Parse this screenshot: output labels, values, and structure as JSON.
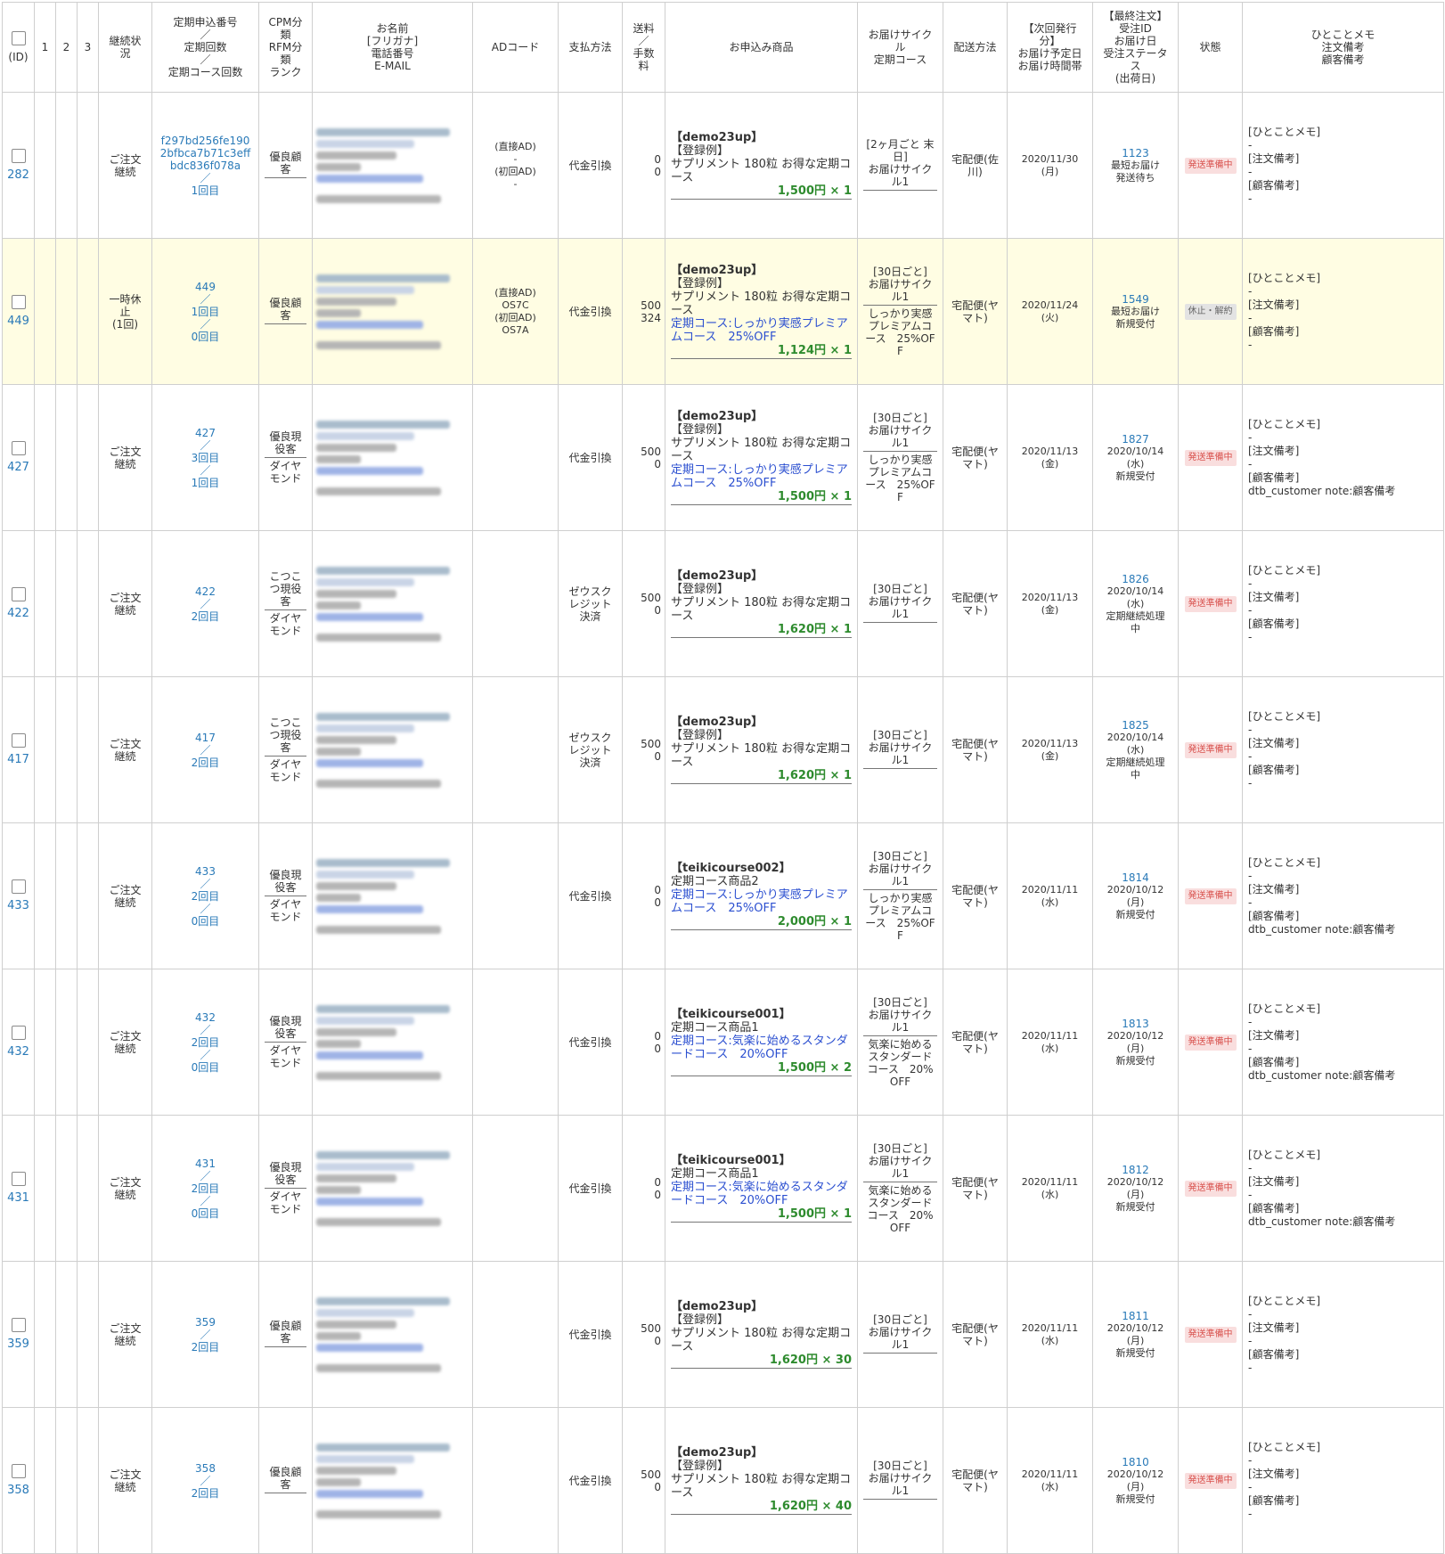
{
  "headers": {
    "id": "(ID)",
    "c1": "1",
    "c2": "2",
    "c3": "3",
    "status": "継続状\n況",
    "regular_no": "定期申込番号\n／\n定期回数\n／\n定期コース回数",
    "cpm": "CPM分\n類\nRFM分\n類\nランク",
    "name": "お名前\n[フリガナ]\n電話番号\nE-MAIL",
    "ad": "ADコード",
    "payment": "支払方法",
    "fee": "送料\n／\n手数\n料",
    "product": "お申込み商品",
    "cycle": "お届けサイク\nル\n定期コース",
    "delivery": "配送方法",
    "next": "【次回発行\n分】\nお届け予定日\nお届け時間帯",
    "last": "【最終注文】\n受注ID\nお届け日\n受注ステータ\nス\n(出荷日)",
    "state": "状態",
    "memo": "ひとことメモ\n注文備考\n顧客備考"
  },
  "memo_labels": {
    "a": "[ひとことメモ]",
    "b": "[注文備考]",
    "c": "[顧客備考]",
    "dash": "-"
  },
  "rows": [
    {
      "id": "282",
      "status": "ご注文\n継続",
      "regular": "f297bd256fe190\n2bfbca7b71c3eff\nbdc836f078a\n／\n1回目",
      "cpm1": "優良顧\n客",
      "cpm2": "",
      "ad": "(直接AD)\n-\n(初回AD)\n-",
      "payment": "代金引換",
      "fee": "0\n0",
      "code": "【demo23up】",
      "pname": "【登録例】\nサプリメント 180粒 お得な定期コ\nース",
      "course": "",
      "price": "1,500円 × 1",
      "cycle1": "[2ヶ月ごと 末\n日]\nお届けサイク\nル1",
      "cycle2": "",
      "delivery": "宅配便(佐\n川)",
      "next": "2020/11/30\n(月)",
      "order_id": "1123",
      "order_info": "最短お届け\n発送待ち",
      "badge": "発送準備中",
      "badge_type": "ship",
      "note": "-"
    },
    {
      "id": "449",
      "status": "一時休\n止\n(1回)",
      "regular": "449\n／\n1回目\n／\n0回目",
      "cpm1": "優良顧\n客",
      "cpm2": "",
      "ad": "(直接AD)\nOS7C\n(初回AD)\nOS7A",
      "payment": "代金引換",
      "fee": "500\n324",
      "code": "【demo23up】",
      "pname": "【登録例】\nサプリメント 180粒 お得な定期コ\nース",
      "course": "定期コース:しっかり実感プレミア\nムコース　25%OFF",
      "price": "1,124円 × 1",
      "cycle1": "[30日ごと]\nお届けサイク\nル1",
      "cycle2": "しっかり実感\nプレミアムコ\nース　25%OF\nF",
      "delivery": "宅配便(ヤ\nマト)",
      "next": "2020/11/24\n(火)",
      "order_id": "1549",
      "order_info": "最短お届け\n新規受付",
      "badge": "休止・解約",
      "badge_type": "stop",
      "note": "-",
      "highlight": true
    },
    {
      "id": "427",
      "status": "ご注文\n継続",
      "regular": "427\n／\n3回目\n／\n1回目",
      "cpm1": "優良現\n役客",
      "cpm2": "ダイヤ\nモンド",
      "ad": "",
      "payment": "代金引換",
      "fee": "500\n0",
      "code": "【demo23up】",
      "pname": "【登録例】\nサプリメント 180粒 お得な定期コ\nース",
      "course": "定期コース:しっかり実感プレミア\nムコース　25%OFF",
      "price": "1,500円 × 1",
      "cycle1": "[30日ごと]\nお届けサイク\nル1",
      "cycle2": "しっかり実感\nプレミアムコ\nース　25%OF\nF",
      "delivery": "宅配便(ヤ\nマト)",
      "next": "2020/11/13\n(金)",
      "order_id": "1827",
      "order_info": "2020/10/14\n(水)\n新規受付",
      "badge": "発送準備中",
      "badge_type": "ship",
      "note": "dtb_customer note:顧客備考"
    },
    {
      "id": "422",
      "status": "ご注文\n継続",
      "regular": "422\n／\n2回目",
      "cpm1": "こつこ\nつ現役\n客",
      "cpm2": "ダイヤ\nモンド",
      "ad": "",
      "payment": "ゼウスク\nレジット\n決済",
      "fee": "500\n0",
      "code": "【demo23up】",
      "pname": "【登録例】\nサプリメント 180粒 お得な定期コ\nース",
      "course": "",
      "price": "1,620円 × 1",
      "cycle1": "[30日ごと]\nお届けサイク\nル1",
      "cycle2": "",
      "delivery": "宅配便(ヤ\nマト)",
      "next": "2020/11/13\n(金)",
      "order_id": "1826",
      "order_info": "2020/10/14\n(水)\n定期継続処理\n中",
      "badge": "発送準備中",
      "badge_type": "ship",
      "note": "-"
    },
    {
      "id": "417",
      "status": "ご注文\n継続",
      "regular": "417\n／\n2回目",
      "cpm1": "こつこ\nつ現役\n客",
      "cpm2": "ダイヤ\nモンド",
      "ad": "",
      "payment": "ゼウスク\nレジット\n決済",
      "fee": "500\n0",
      "code": "【demo23up】",
      "pname": "【登録例】\nサプリメント 180粒 お得な定期コ\nース",
      "course": "",
      "price": "1,620円 × 1",
      "cycle1": "[30日ごと]\nお届けサイク\nル1",
      "cycle2": "",
      "delivery": "宅配便(ヤ\nマト)",
      "next": "2020/11/13\n(金)",
      "order_id": "1825",
      "order_info": "2020/10/14\n(水)\n定期継続処理\n中",
      "badge": "発送準備中",
      "badge_type": "ship",
      "note": "-"
    },
    {
      "id": "433",
      "status": "ご注文\n継続",
      "regular": "433\n／\n2回目\n／\n0回目",
      "cpm1": "優良現\n役客",
      "cpm2": "ダイヤ\nモンド",
      "ad": "",
      "payment": "代金引換",
      "fee": "0\n0",
      "code": "【teikicourse002】",
      "pname": "定期コース商品2",
      "course": "定期コース:しっかり実感プレミア\nムコース　25%OFF",
      "price": "2,000円 × 1",
      "cycle1": "[30日ごと]\nお届けサイク\nル1",
      "cycle2": "しっかり実感\nプレミアムコ\nース　25%OF\nF",
      "delivery": "宅配便(ヤ\nマト)",
      "next": "2020/11/11\n(水)",
      "order_id": "1814",
      "order_info": "2020/10/12\n(月)\n新規受付",
      "badge": "発送準備中",
      "badge_type": "ship",
      "note": "dtb_customer note:顧客備考"
    },
    {
      "id": "432",
      "status": "ご注文\n継続",
      "regular": "432\n／\n2回目\n／\n0回目",
      "cpm1": "優良現\n役客",
      "cpm2": "ダイヤ\nモンド",
      "ad": "",
      "payment": "代金引換",
      "fee": "0\n0",
      "code": "【teikicourse001】",
      "pname": "定期コース商品1",
      "course": "定期コース:気楽に始めるスタンダ\nードコース　20%OFF",
      "price": "1,500円 × 2",
      "cycle1": "[30日ごと]\nお届けサイク\nル1",
      "cycle2": "気楽に始める\nスタンダード\nコース　20%\nOFF",
      "delivery": "宅配便(ヤ\nマト)",
      "next": "2020/11/11\n(水)",
      "order_id": "1813",
      "order_info": "2020/10/12\n(月)\n新規受付",
      "badge": "発送準備中",
      "badge_type": "ship",
      "note": "dtb_customer note:顧客備考"
    },
    {
      "id": "431",
      "status": "ご注文\n継続",
      "regular": "431\n／\n2回目\n／\n0回目",
      "cpm1": "優良現\n役客",
      "cpm2": "ダイヤ\nモンド",
      "ad": "",
      "payment": "代金引換",
      "fee": "0\n0",
      "code": "【teikicourse001】",
      "pname": "定期コース商品1",
      "course": "定期コース:気楽に始めるスタンダ\nードコース　20%OFF",
      "price": "1,500円 × 1",
      "cycle1": "[30日ごと]\nお届けサイク\nル1",
      "cycle2": "気楽に始める\nスタンダード\nコース　20%\nOFF",
      "delivery": "宅配便(ヤ\nマト)",
      "next": "2020/11/11\n(水)",
      "order_id": "1812",
      "order_info": "2020/10/12\n(月)\n新規受付",
      "badge": "発送準備中",
      "badge_type": "ship",
      "note": "dtb_customer note:顧客備考"
    },
    {
      "id": "359",
      "status": "ご注文\n継続",
      "regular": "359\n／\n2回目",
      "cpm1": "優良顧\n客",
      "cpm2": "",
      "ad": "",
      "payment": "代金引換",
      "fee": "500\n0",
      "code": "【demo23up】",
      "pname": "【登録例】\nサプリメント 180粒 お得な定期コ\nース",
      "course": "",
      "price": "1,620円 × 30",
      "cycle1": "[30日ごと]\nお届けサイク\nル1",
      "cycle2": "",
      "delivery": "宅配便(ヤ\nマト)",
      "next": "2020/11/11\n(水)",
      "order_id": "1811",
      "order_info": "2020/10/12\n(月)\n新規受付",
      "badge": "発送準備中",
      "badge_type": "ship",
      "note": "-"
    },
    {
      "id": "358",
      "status": "ご注文\n継続",
      "regular": "358\n／\n2回目",
      "cpm1": "優良顧\n客",
      "cpm2": "",
      "ad": "",
      "payment": "代金引換",
      "fee": "500\n0",
      "code": "【demo23up】",
      "pname": "【登録例】\nサプリメント 180粒 お得な定期コ\nース",
      "course": "",
      "price": "1,620円 × 40",
      "cycle1": "[30日ごと]\nお届けサイク\nル1",
      "cycle2": "",
      "delivery": "宅配便(ヤ\nマト)",
      "next": "2020/11/11\n(水)",
      "order_id": "1810",
      "order_info": "2020/10/12\n(月)\n新規受付",
      "badge": "発送準備中",
      "badge_type": "ship",
      "note": "-"
    }
  ]
}
